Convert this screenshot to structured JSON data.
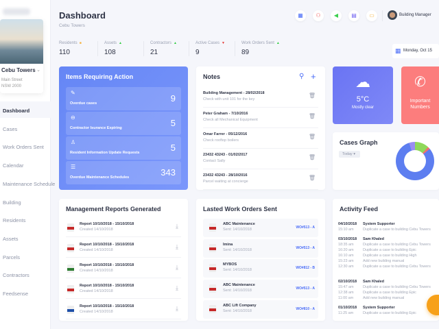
{
  "sidebar": {
    "building": {
      "name": "Cebu Towers",
      "address1": "Main Street",
      "address2": "NSW 2000"
    },
    "items": [
      {
        "label": "Dashboard"
      },
      {
        "label": "Cases"
      },
      {
        "label": "Work Orders Sent"
      },
      {
        "label": "Calendar"
      },
      {
        "label": "Maintenance Schedule"
      },
      {
        "label": "Building"
      },
      {
        "label": "Residents"
      },
      {
        "label": "Assets"
      },
      {
        "label": "Parcels"
      },
      {
        "label": "Contractors"
      },
      {
        "label": "Feedsense"
      }
    ]
  },
  "header": {
    "title": "Dashboard",
    "subtitle": "Cebu Towers",
    "user": "Building Manager",
    "icons": [
      "calculator-icon",
      "people-icon",
      "megaphone-icon",
      "inbox-icon",
      "monitor-icon"
    ],
    "date": "Monday, Oct 15"
  },
  "stats": [
    {
      "label": "Residents",
      "value": "110",
      "trend": "flat"
    },
    {
      "label": "Assets",
      "value": "108",
      "trend": "up"
    },
    {
      "label": "Contractors",
      "value": "21",
      "trend": "up"
    },
    {
      "label": "Active Cases",
      "value": "9",
      "trend": "down"
    },
    {
      "label": "Work Orders Sent",
      "value": "89",
      "trend": "up"
    }
  ],
  "colors": {
    "up": "#2ecc40",
    "down": "#e53935",
    "flat": "#f5b342",
    "accent": "#4a6cf7"
  },
  "actions": {
    "title": "Items Requiring Action",
    "items": [
      {
        "label": "Overdue cases",
        "count": "9",
        "icon": "✎"
      },
      {
        "label": "Contractor Isurance Expiring",
        "count": "5",
        "icon": "⊖"
      },
      {
        "label": "Resident Information Update Requests",
        "count": "5",
        "icon": "♙"
      },
      {
        "label": "Overdue Maintenance Schedules",
        "count": "343",
        "icon": "☰"
      }
    ]
  },
  "notes": {
    "title": "Notes",
    "items": [
      {
        "title": "Building Management - 28/02/2018",
        "desc": "Check with unit 101 for the key"
      },
      {
        "title": "Peter Graham - 7/10/2016",
        "desc": "Check all Mechanical Equipment"
      },
      {
        "title": "Omar Farrer - 05/12/2016",
        "desc": "Check rooftop boilers"
      },
      {
        "title": "23432 43243 - 01/02/2017",
        "desc": "Contact Sally"
      },
      {
        "title": "23432 43243 - 28/10/2016",
        "desc": "Parcel waiting at concierge"
      }
    ]
  },
  "weather": {
    "temp": "5°C",
    "desc": "Mostly clear"
  },
  "important": {
    "label1": "Important",
    "label2": "Numbers"
  },
  "cases_graph": {
    "title": "Cases Graph",
    "filter": "Today"
  },
  "reports": {
    "title": "Management Reports Generated",
    "items": [
      {
        "title": "Report 10/10/2018 - 15/10/2018",
        "created": "Created 14/10/2018",
        "color": "#c62828"
      },
      {
        "title": "Report 10/10/2018 - 15/10/2018",
        "created": "Created 14/10/2018",
        "color": "#c62828"
      },
      {
        "title": "Report 10/10/2018 - 15/10/2018",
        "created": "Created 14/10/2018",
        "color": "#2e7d32"
      },
      {
        "title": "Report 10/10/2018 - 15/10/2018",
        "created": "Created 14/10/2018",
        "color": "#c62828"
      },
      {
        "title": "Report 10/10/2018 - 15/10/2018",
        "created": "Created 14/10/2018",
        "color": "#1e4fa8"
      }
    ]
  },
  "work_orders": {
    "title": "Lasted Work Orders Sent",
    "items": [
      {
        "name": "ABC Maintenance",
        "sent": "Sent: 14/10/2018",
        "code": "WO#513 - A"
      },
      {
        "name": "Imina",
        "sent": "Sent: 14/10/2018",
        "code": "WO#513 - A"
      },
      {
        "name": "MYBOS",
        "sent": "Sent: 14/10/2018",
        "code": "WO#812 - B"
      },
      {
        "name": "ABC Maintenance",
        "sent": "Sent: 14/10/2018",
        "code": "WO#513 - A"
      },
      {
        "name": "ABC Lift Company",
        "sent": "Sent: 14/10/2018",
        "code": "WO#810 - A"
      }
    ]
  },
  "activity": {
    "title": "Activity Feed",
    "groups": [
      {
        "date": "04/10/2018",
        "user": "System Supporter",
        "entries": [
          {
            "time": "15:10 am",
            "text": "Duplicate a case to building Cebu Towers"
          }
        ]
      },
      {
        "date": "03/10/2018",
        "user": "Sam Khaled",
        "entries": [
          {
            "time": "18:35 am",
            "text": "Duplicate a case to building Cebu Towers"
          },
          {
            "time": "16:20 am",
            "text": "Duplicate a case to building Epic"
          },
          {
            "time": "16:10 am",
            "text": "Duplicate a case to building High"
          },
          {
            "time": "15:23 am",
            "text": "Add new building manual"
          },
          {
            "time": "12:30 am",
            "text": "Duplicate a case to building Cebu Towers"
          }
        ]
      },
      {
        "date": "02/10/2018",
        "user": "Sam Khaled",
        "entries": [
          {
            "time": "15:47 am",
            "text": "Duplicate a case to building Cebu Towers"
          },
          {
            "time": "12:38 am",
            "text": "Duplicate a case to building Epic"
          },
          {
            "time": "11:00 am",
            "text": "Add new building manual"
          }
        ]
      },
      {
        "date": "01/10/2018",
        "user": "System Supporter",
        "entries": [
          {
            "time": "11:25 am",
            "text": "Duplicate a case to building Epic"
          }
        ]
      }
    ]
  }
}
